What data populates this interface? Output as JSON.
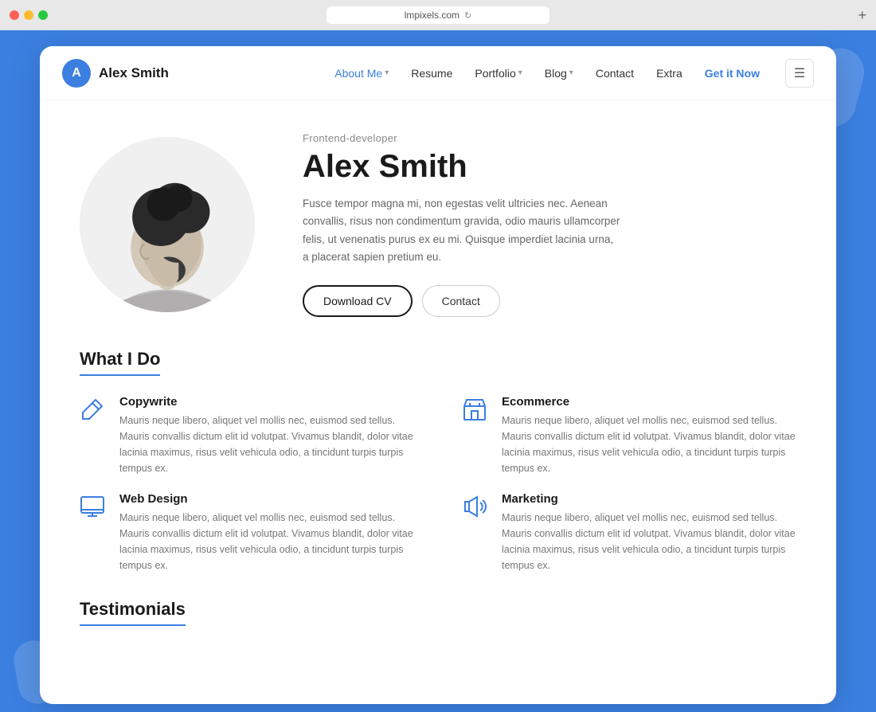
{
  "browser": {
    "url": "lmpixels.com",
    "new_tab_label": "+"
  },
  "nav": {
    "logo_initial": "A",
    "logo_name": "Alex Smith",
    "links": [
      {
        "label": "About Me",
        "has_caret": true,
        "active": false
      },
      {
        "label": "Resume",
        "has_caret": false,
        "active": false
      },
      {
        "label": "Portfolio",
        "has_caret": true,
        "active": false
      },
      {
        "label": "Blog",
        "has_caret": true,
        "active": false
      },
      {
        "label": "Contact",
        "has_caret": false,
        "active": false
      },
      {
        "label": "Extra",
        "has_caret": false,
        "active": false
      }
    ],
    "cta_label": "Get it Now"
  },
  "hero": {
    "subtitle": "Frontend-developer",
    "name": "Alex Smith",
    "bio": "Fusce tempor magna mi, non egestas velit ultricies nec. Aenean convallis, risus non condimentum gravida, odio mauris ullamcorper felis, ut venenatis purus ex eu mi. Quisque imperdiet lacinia urna, a placerat sapien pretium eu.",
    "btn_cv": "Download CV",
    "btn_contact": "Contact"
  },
  "what_i_do": {
    "title": "What I Do",
    "services": [
      {
        "icon": "pencil",
        "title": "Copywrite",
        "desc": "Mauris neque libero, aliquet vel mollis nec, euismod sed tellus. Mauris convallis dictum elit id volutpat. Vivamus blandit, dolor vitae lacinia maximus, risus velit vehicula odio, a tincidunt turpis turpis tempus ex."
      },
      {
        "icon": "store",
        "title": "Ecommerce",
        "desc": "Mauris neque libero, aliquet vel mollis nec, euismod sed tellus. Mauris convallis dictum elit id volutpat. Vivamus blandit, dolor vitae lacinia maximus, risus velit vehicula odio, a tincidunt turpis turpis tempus ex."
      },
      {
        "icon": "monitor",
        "title": "Web Design",
        "desc": "Mauris neque libero, aliquet vel mollis nec, euismod sed tellus. Mauris convallis dictum elit id volutpat. Vivamus blandit, dolor vitae lacinia maximus, risus velit vehicula odio, a tincidunt turpis turpis tempus ex."
      },
      {
        "icon": "megaphone",
        "title": "Marketing",
        "desc": "Mauris neque libero, aliquet vel mollis nec, euismod sed tellus. Mauris convallis dictum elit id volutpat. Vivamus blandit, dolor vitae lacinia maximus, risus velit vehicula odio, a tincidunt turpis turpis tempus ex."
      }
    ]
  },
  "testimonials": {
    "title": "Testimonials"
  },
  "colors": {
    "accent": "#3b7fe0",
    "bg": "#3b7fe0"
  }
}
